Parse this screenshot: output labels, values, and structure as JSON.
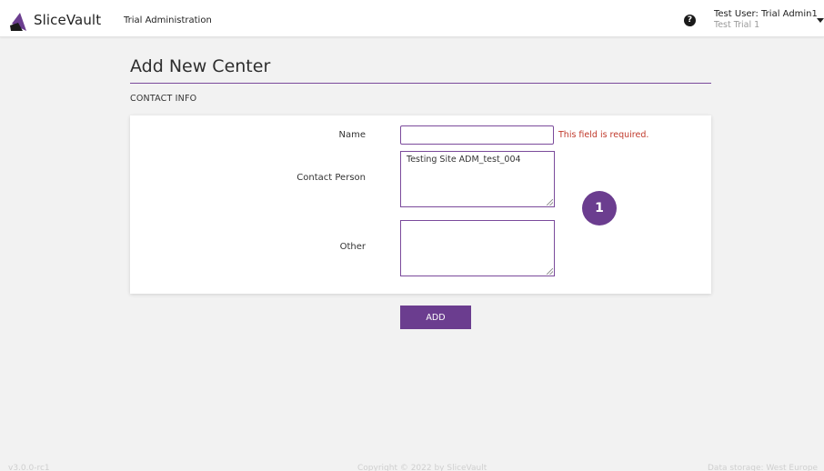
{
  "header": {
    "app_name": "SliceVault",
    "nav_link": "Trial Administration",
    "help_glyph": "?",
    "user_name": "Test User: Trial Admin1",
    "user_trial": "Test Trial 1"
  },
  "page": {
    "title": "Add New Center",
    "section_label": "CONTACT INFO"
  },
  "form": {
    "name_label": "Name",
    "name_value": "",
    "name_error": "This field is required.",
    "contact_label": "Contact Person",
    "contact_value": "Testing Site ADM_test_004",
    "other_label": "Other",
    "other_value": "",
    "submit_label": "ADD"
  },
  "annotation": {
    "step_number": "1"
  },
  "footer": {
    "version": "v3.0.0-rc1",
    "copyright": "Copyright © 2022 by SliceVault",
    "storage": "Data storage: West Europe"
  },
  "colors": {
    "accent": "#6b3d8f",
    "error": "#c0392b",
    "background": "#f2f2f2"
  }
}
